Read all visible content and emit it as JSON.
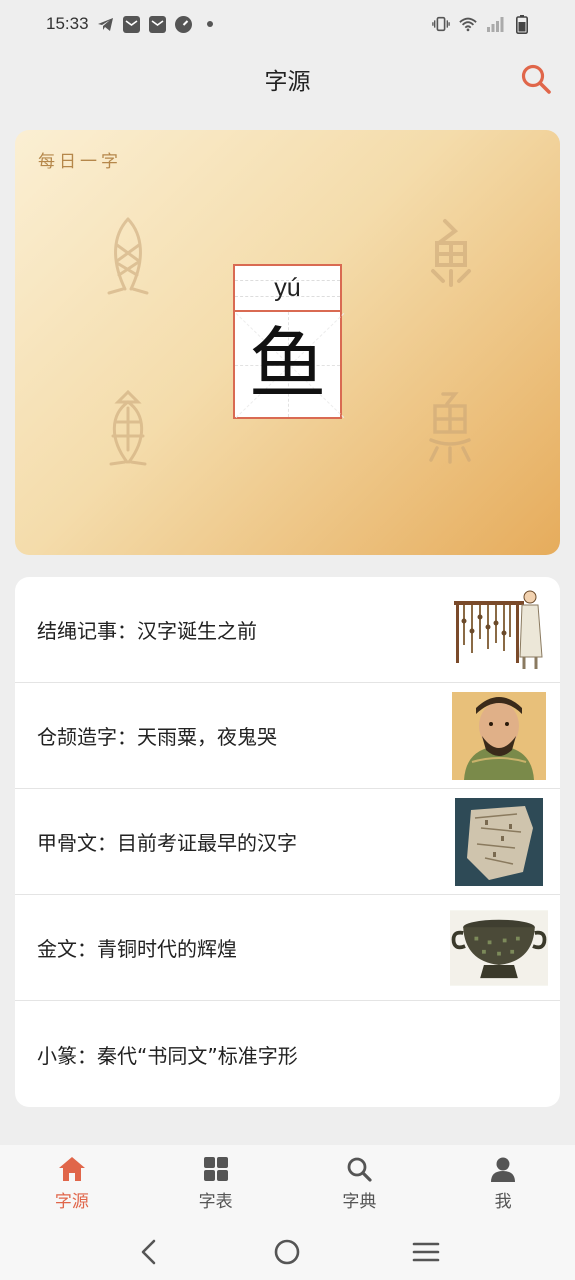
{
  "status": {
    "time": "15:33",
    "icons": [
      "telegram-icon",
      "mail-icon",
      "mail-icon",
      "speed-icon",
      "dot-icon",
      "vibrate-icon",
      "wifi-icon",
      "signal-icon",
      "battery-icon"
    ]
  },
  "header": {
    "title": "字源",
    "search_icon": "search-icon"
  },
  "daily": {
    "label": "每日一字",
    "pinyin": "yú",
    "character": "鱼"
  },
  "articles": [
    {
      "title": "结绳记事：汉字诞生之前",
      "thumb": "knotted-rope-illustration"
    },
    {
      "title": "仓颉造字：天雨粟，夜鬼哭",
      "thumb": "cangjie-portrait"
    },
    {
      "title": "甲骨文：目前考证最早的汉字",
      "thumb": "oracle-bone"
    },
    {
      "title": "金文：青铜时代的辉煌",
      "thumb": "bronze-vessel"
    },
    {
      "title": "小篆：秦代“书同文”标准字形",
      "thumb": ""
    }
  ],
  "nav": {
    "items": [
      {
        "label": "字源",
        "icon": "home-icon",
        "active": true
      },
      {
        "label": "字表",
        "icon": "grid-icon",
        "active": false
      },
      {
        "label": "字典",
        "icon": "search-icon",
        "active": false
      },
      {
        "label": "我",
        "icon": "user-icon",
        "active": false
      }
    ]
  },
  "colors": {
    "accent": "#e0664a",
    "card_gradient_start": "#fbefd3",
    "card_gradient_end": "#e6ac5c"
  }
}
